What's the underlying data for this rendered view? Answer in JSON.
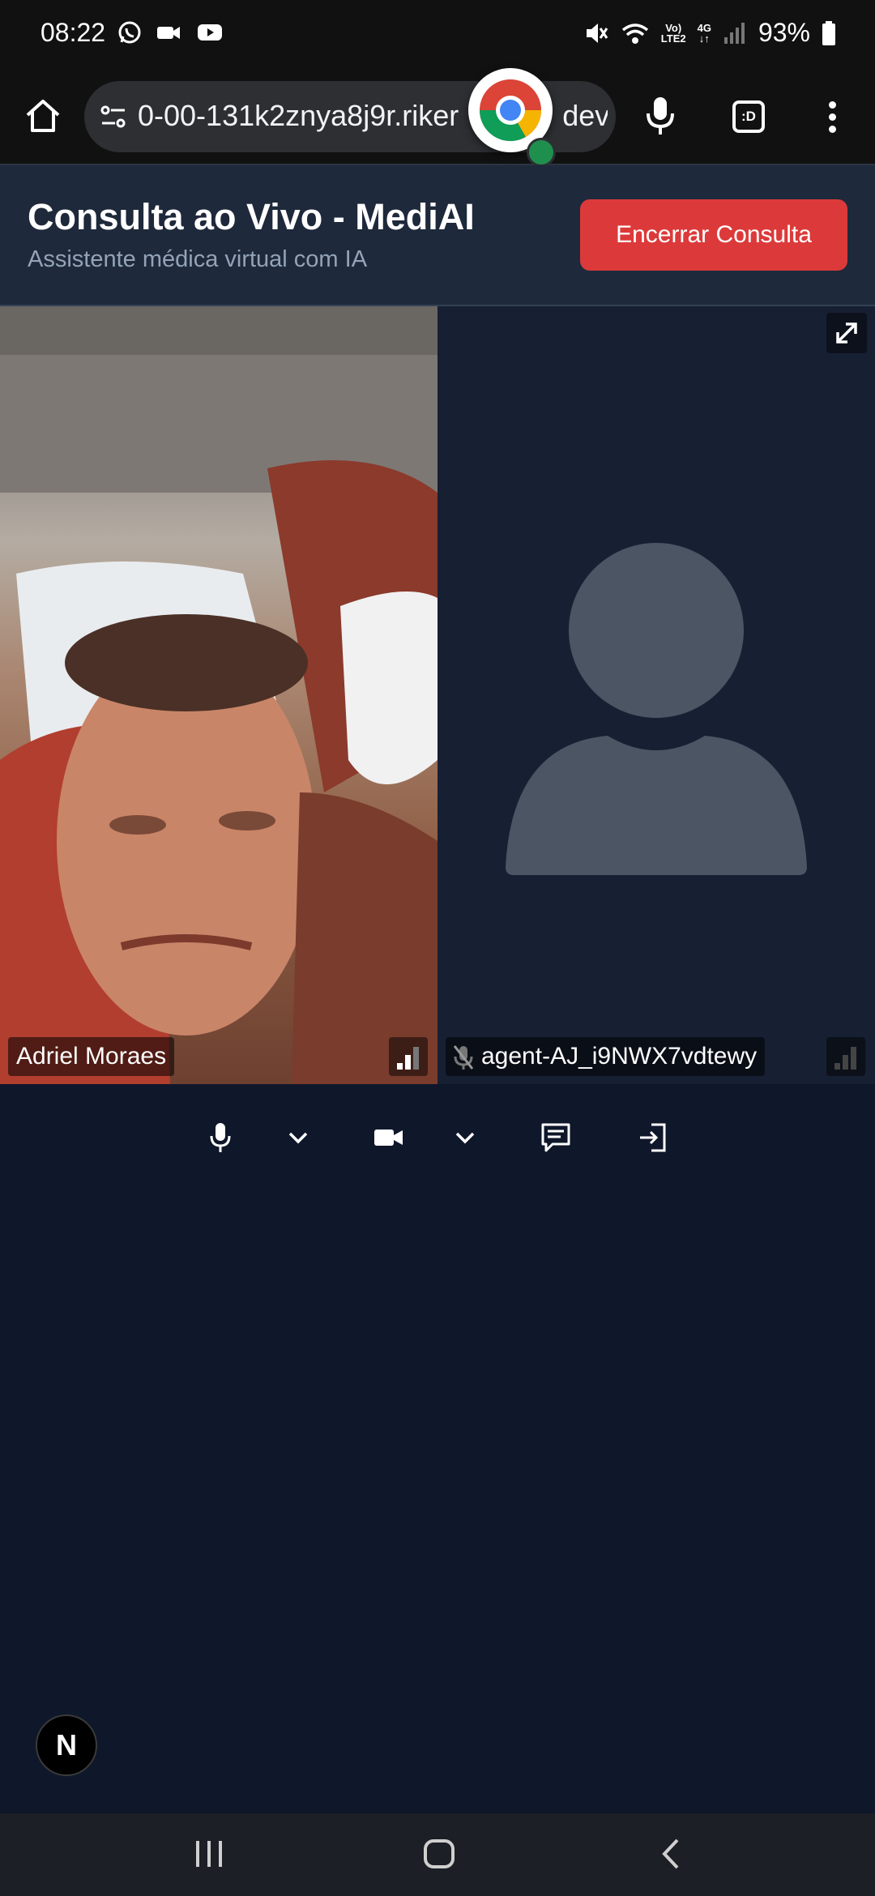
{
  "status_bar": {
    "time": "08:22",
    "battery_percent": "93%",
    "network_label_top": "Vo)",
    "network_label_bottom": "LTE2",
    "network_type": "4G",
    "icons": [
      "whatsapp-icon",
      "video-call-icon",
      "youtube-icon",
      "mute-icon",
      "wifi-icon",
      "signal-icon",
      "battery-icon"
    ]
  },
  "browser": {
    "url": "0-00-131k2znya8j9r.riker",
    "url_suffix": "dev",
    "tab_switcher_label": ":D",
    "icons": [
      "home-icon",
      "site-settings-icon",
      "chrome-icon",
      "mic-icon",
      "menu-icon"
    ]
  },
  "header": {
    "title": "Consulta ao Vivo - MediAI",
    "subtitle": "Assistente médica virtual com IA",
    "end_button_label": "Encerrar Consulta",
    "end_button_color": "#dc3a3a"
  },
  "participants": [
    {
      "name": "Adriel Moraes",
      "video": "camera-feed",
      "muted": false
    },
    {
      "name": "agent-AJ_i9NWX7vdtewy",
      "video": "avatar-placeholder",
      "muted": true
    }
  ],
  "controls": {
    "icons": [
      "microphone-icon",
      "chevron-down-icon",
      "camera-icon",
      "chevron-down-icon",
      "chat-icon",
      "leave-icon"
    ]
  },
  "next_badge": {
    "label": "N"
  },
  "colors": {
    "page_bg": "#0f172a",
    "header_bg": "#1e293b",
    "agent_tile_bg": "#172033",
    "avatar": "#4b5563"
  }
}
